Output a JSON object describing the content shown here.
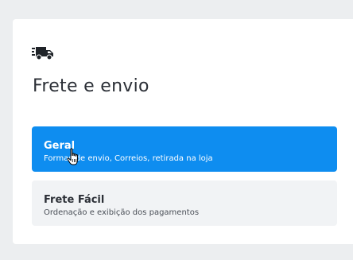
{
  "section": {
    "icon": "truck-icon",
    "title": "Frete e envio"
  },
  "menu": {
    "items": [
      {
        "label": "Geral",
        "description": "Formas de envio, Correios, retirada na loja",
        "state": "selected"
      },
      {
        "label": "Frete Fácil",
        "description": "Ordenação e exibição dos pagamentos",
        "state": "default"
      }
    ]
  },
  "colors": {
    "accent": "#0e8df0",
    "panel": "#ffffff",
    "background": "#eceef0",
    "item_inactive": "#f1f3f5",
    "text_dark": "#2b2f36"
  },
  "cursor": "hand-pointer-icon"
}
